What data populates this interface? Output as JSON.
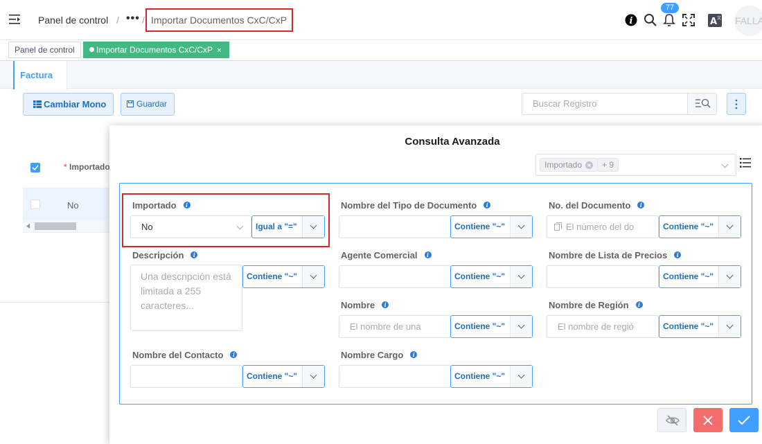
{
  "header": {
    "breadcrumb_home": "Panel de control",
    "breadcrumb_sep": "/",
    "breadcrumb_more": "•••",
    "breadcrumb_current": "Importar Documentos CxC/CxP",
    "notification_count": "77",
    "avatar_text": "FALLA",
    "icons": [
      "menu-fold-icon",
      "info-icon",
      "search-icon",
      "bell-icon",
      "fullscreen-icon",
      "language-icon"
    ]
  },
  "tags": {
    "home": "Panel de control",
    "active": "Importar Documentos CxC/CxP",
    "close": "×",
    "active_color": "#42b983"
  },
  "page": {
    "tab": "Factura",
    "cambiar_mono": "Cambiar Mono",
    "guardar": "Guardar",
    "search_placeholder": "Buscar Registro",
    "table_header": "Importado",
    "table_required_mark": "*",
    "table_row_value": "No"
  },
  "dialog": {
    "title": "Consulta Avanzada",
    "chip_1": "Importado",
    "chip_2": "+ 9",
    "fields": {
      "importado": {
        "label": "Importado",
        "value": "No",
        "operator": "Igual a \"=\""
      },
      "tipo_documento": {
        "label": "Nombre del Tipo de Documento",
        "value": "",
        "operator": "Contiene \"~\""
      },
      "no_documento": {
        "label": "No. del Documento",
        "placeholder": "El número del do",
        "operator": "Contiene \"~\""
      },
      "descripcion": {
        "label": "Descripción",
        "placeholder": "Una descripción está limitada a 255 caracteres...",
        "operator": "Contiene \"~\""
      },
      "agente": {
        "label": "Agente Comercial",
        "value": "",
        "operator": "Contiene \"~\""
      },
      "lista_precios": {
        "label": "Nombre de Lista de Precios",
        "value": "",
        "operator": "Contiene \"~\""
      },
      "nombre": {
        "label": "Nombre",
        "placeholder": "El nombre de una",
        "operator": "Contiene \"~\""
      },
      "region": {
        "label": "Nombre de Región",
        "placeholder": "El nombre de regió",
        "operator": "Contiene \"~\""
      },
      "contacto": {
        "label": "Nombre del Contacto",
        "value": "",
        "operator": "Contiene \"~\""
      },
      "cargo": {
        "label": "Nombre Cargo",
        "value": "",
        "operator": "Contiene \"~\""
      }
    },
    "buttons": {
      "clear": "clear-filter-icon",
      "cancel": "close-icon",
      "ok": "check-icon"
    },
    "accent": "#409eff",
    "danger": "#f56c6c"
  }
}
